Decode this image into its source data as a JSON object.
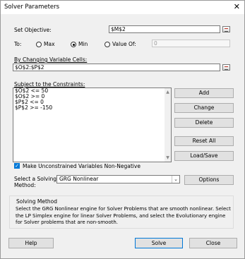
{
  "window": {
    "title": "Solver Parameters",
    "close_glyph": "✕"
  },
  "objective": {
    "label": "Set Objective:",
    "value": "$M$2"
  },
  "to": {
    "label": "To:",
    "max_label": "Max",
    "min_label": "Min",
    "value_of_label": "Value Of:",
    "value_of_value": "0",
    "selected": "Min"
  },
  "changing": {
    "label": "By Changing Variable Cells:",
    "value": "$O$2:$P$2"
  },
  "constraints": {
    "label": "Subject to the Constraints:",
    "items": [
      "$O$2 <= 50",
      "$O$2 >= 0",
      "$P$2 <= 0",
      "$P$2 >= -150"
    ]
  },
  "side_buttons": {
    "add": "Add",
    "change": "Change",
    "delete": "Delete",
    "reset_all": "Reset All",
    "load_save": "Load/Save"
  },
  "nonneg": {
    "label": "Make Unconstrained Variables Non-Negative",
    "checked": true
  },
  "method": {
    "label_line1": "Select a Solving",
    "label_line2": "Method:",
    "selected": "GRG Nonlinear",
    "options_button": "Options"
  },
  "solving_method": {
    "title": "Solving Method",
    "text": "Select the GRG Nonlinear engine for Solver Problems that are smooth nonlinear. Select the LP Simplex engine for linear Solver Problems, and select the Evolutionary engine for Solver problems that are non-smooth."
  },
  "footer": {
    "help": "Help",
    "solve": "Solve",
    "close": "Close"
  },
  "icons": [
    "close-icon",
    "range-select-icon",
    "scroll-up-icon",
    "scroll-down-icon",
    "dropdown-arrow-icon",
    "checkmark-icon"
  ],
  "colors": {
    "accent": "#0078d7",
    "background": "#f0f0f0"
  }
}
